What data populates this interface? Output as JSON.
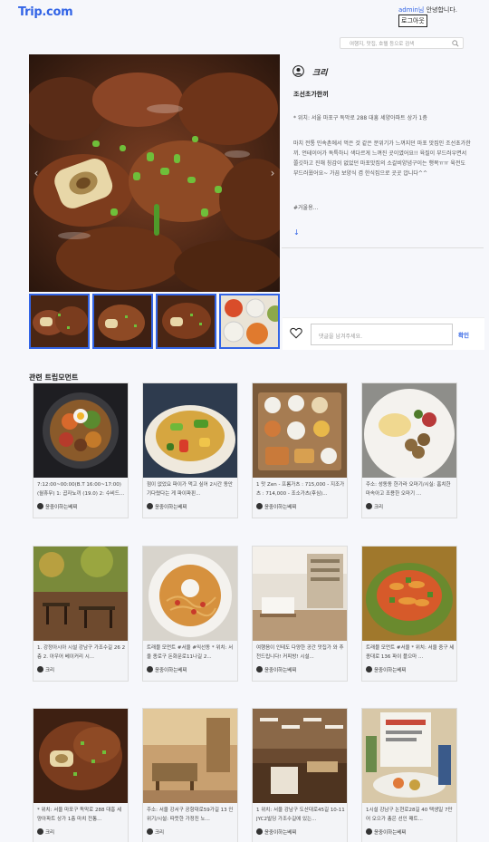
{
  "header": {
    "logo": "Trip.com",
    "greeting_user": "admin님",
    "greeting_suffix": " 안녕합니다.",
    "logout_label": "로그아웃"
  },
  "search": {
    "placeholder": "여행지, 맛집, 호텔 등으로 검색"
  },
  "post": {
    "author": "크리",
    "title": "조선초가한끼",
    "location": "* 위치: 서울 마포구 독막로 288 대흥 세양아파트 상가 1층",
    "body": "마치 전통 민속촌에서 먹은 것 같은 분위기가 느껴지던 마포 맛집인 조선초가한끼. 언테이어가 독특하니 색다르게 느껴진 곳이였어요!! 육질이 부드러우면서 쫄깃하고 진해 칭감이 없었던 마포맛집의 소갈비양념구이는 행복ㅠㅠ 육전도 부드러웠어요~ 가끔 보양식 겸 한식집으로 곳곳 압니다^^",
    "tags": "#거울용...",
    "more": "↓"
  },
  "comment": {
    "placeholder": "댓글을 남겨주세요.",
    "submit_label": "확인"
  },
  "related": {
    "title": "관련 트립모먼트",
    "cards": [
      {
        "desc": "7:12:00~00:00(B.T 16:00~17:00)(월휴무) 1: 곱자뇨끼 (19.0) 2: 수비드...",
        "author": "윤중이하는베찌"
      },
      {
        "desc": "점이 없었요 파이가 먹고 싶어 2시간 동안 기다렸다는 게 파이파핀...",
        "author": "윤중이하는베찌"
      },
      {
        "desc": "1 맛 Zen - 프롬가츠 : 715,000 - 지조가츠 : 714,000 - 조소가츠(후심)...",
        "author": "윤중이하는베찌"
      },
      {
        "desc": "주소: 성동동 한가라 오마기/시실: 홈치한 마속아고 조용한 오마기 ...",
        "author": "크리"
      },
      {
        "desc": "1. 강정아시아 시설 강남구 가조수길 26 2층 2. 아우어 베이커리 시...",
        "author": "크리"
      },
      {
        "desc": "트래블 모먼트 #서울 #익선동 * 위치: 서울 종로구 돈화문로11나길 2...",
        "author": "윤중이하는베찌"
      },
      {
        "desc": "여행음이 인테도 다양한 공간 맛집가 와 추천드립니다! 커피방! 시설...",
        "author": "윤중이하는베찌"
      },
      {
        "desc": "트래블 모먼트 #서울 * 위치: 서울 중구 세종대로 136 파이 플으마 ...",
        "author": "윤중이하는베찌"
      },
      {
        "desc": "* 위치: 서울 마포구 독막로 288 대흥 세양아파트 상가 1층 마치 전통...",
        "author": "크리"
      },
      {
        "desc": "주소: 서울 강서구 공항대로59가길 13 인위기/시설: 따뜻한 가정진 노...",
        "author": "크리"
      },
      {
        "desc": "1 위치: 서울 강남구 도산대로45길 10-11 JYC2빌딩 가조수길에 있는...",
        "author": "윤중이하는베찌"
      },
      {
        "desc": "1시설 강남구 논현로28길 40 택생일 7만어 오으가 총은 선인 매트...",
        "author": "윤중이하는베찌"
      }
    ]
  },
  "colors": {
    "accent": "#3264e6",
    "background": "#f6f7fb"
  }
}
